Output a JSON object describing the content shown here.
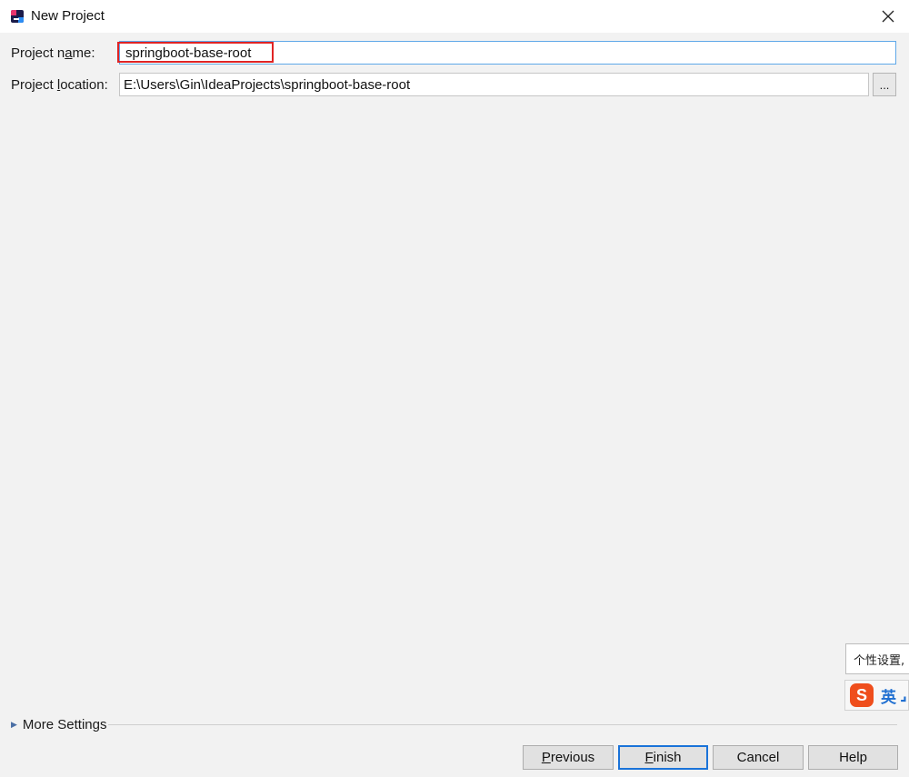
{
  "window": {
    "title": "New Project",
    "app_icon": "intellij-idea-icon",
    "close_icon": "close-icon"
  },
  "form": {
    "project_name_label_pre": "Project n",
    "project_name_label_key": "a",
    "project_name_label_post": "me:",
    "project_name_value": "springboot-base-root",
    "project_location_label_pre": "Project ",
    "project_location_label_key": "l",
    "project_location_label_post": "ocation:",
    "project_location_value": "E:\\Users\\Gin\\IdeaProjects\\springboot-base-root",
    "browse_label": "..."
  },
  "more_settings": {
    "label_pre": "More Settin",
    "label_key": "g",
    "label_post": "s"
  },
  "buttons": {
    "previous_key": "P",
    "previous_rest": "revious",
    "finish_key": "F",
    "finish_rest": "inish",
    "cancel": "Cancel",
    "help": "Help"
  },
  "ime": {
    "tooltip": "个性设置,",
    "logo_letter": "S",
    "mode": "英",
    "extra": "⌟"
  },
  "colors": {
    "accent": "#1a73d9",
    "highlight": "#e02424",
    "ime_brand": "#ef4e1c"
  }
}
